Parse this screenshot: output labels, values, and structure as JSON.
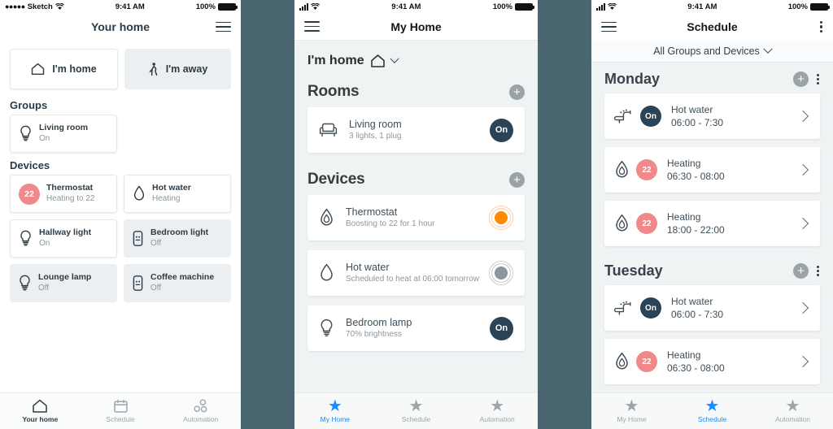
{
  "panels": {
    "home": {
      "status": {
        "carrier": "Sketch",
        "time": "9:41 AM",
        "battery": "100%"
      },
      "nav": {
        "title": "Your home",
        "menu_icon": "hamburger-icon"
      },
      "modes": [
        {
          "label": "I'm home",
          "icon": "home-icon",
          "state": "active"
        },
        {
          "label": "I'm away",
          "icon": "walking-person-icon",
          "state": "inactive"
        }
      ],
      "groups_heading": "Groups",
      "groups": [
        {
          "name": "Living room",
          "status": "On",
          "icon": "bulb-icon",
          "state": "on"
        }
      ],
      "devices_heading": "Devices",
      "devices": [
        {
          "name": "Thermostat",
          "status": "Heating to 22",
          "icon": "temp-badge",
          "badge": "22",
          "state": "on"
        },
        {
          "name": "Hot water",
          "status": "Heating",
          "icon": "droplet-icon",
          "state": "on"
        },
        {
          "name": "Hallway light",
          "status": "On",
          "icon": "bulb-icon",
          "state": "on"
        },
        {
          "name": "Bedroom light",
          "status": "Off",
          "icon": "plug-icon",
          "state": "off"
        },
        {
          "name": "Lounge lamp",
          "status": "Off",
          "icon": "bulb-icon",
          "state": "off"
        },
        {
          "name": "Coffee machine",
          "status": "Off",
          "icon": "plug-icon",
          "state": "off"
        }
      ],
      "tabs": [
        {
          "label": "Your home",
          "icon": "home-icon",
          "selected": true
        },
        {
          "label": "Schedule",
          "icon": "calendar-icon",
          "selected": false
        },
        {
          "label": "Automation",
          "icon": "automation-nodes-icon",
          "selected": false
        }
      ]
    },
    "myhome": {
      "status": {
        "time": "9:41 AM",
        "battery": "100%"
      },
      "nav": {
        "title": "My Home",
        "menu_icon": "hamburger-icon"
      },
      "mode": {
        "label": "I'm home",
        "icon": "home-icon",
        "chevron": "chevron-down-icon"
      },
      "rooms_heading": "Rooms",
      "rooms_add": "+",
      "rooms": [
        {
          "name": "Living room",
          "sub": "3 lights, 1 plug",
          "icon": "armchair-icon",
          "toggle": "On",
          "toggle_type": "pill"
        }
      ],
      "devices_heading": "Devices",
      "devices_add": "+",
      "devices": [
        {
          "name": "Thermostat",
          "sub": "Boosting to 22 for 1 hour",
          "icon": "flame-droplet-icon",
          "toggle_type": "dial",
          "toggle_state": "orange"
        },
        {
          "name": "Hot water",
          "sub": "Scheduled to heat at 06:00 tomorrow",
          "icon": "droplet-icon",
          "toggle_type": "dial",
          "toggle_state": "grey"
        },
        {
          "name": "Bedroom lamp",
          "sub": "70% brightness",
          "icon": "bulb-icon",
          "toggle": "On",
          "toggle_type": "pill"
        }
      ],
      "tabs": [
        {
          "label": "My Home",
          "icon": "star-icon",
          "selected": true
        },
        {
          "label": "Schedule",
          "icon": "star-icon",
          "selected": false
        },
        {
          "label": "Automation",
          "icon": "star-icon",
          "selected": false
        }
      ]
    },
    "schedule": {
      "status": {
        "time": "9:41 AM",
        "battery": "100%"
      },
      "nav": {
        "title": "Schedule",
        "menu_icon": "hamburger-icon",
        "overflow_icon": "kebab-icon"
      },
      "filter": {
        "label": "All Groups and Devices",
        "chevron": "chevron-down-icon"
      },
      "days": [
        {
          "name": "Monday",
          "add": "+",
          "entries": [
            {
              "name": "Hot water",
              "time": "06:00 - 7:30",
              "icon": "tap-icon",
              "badge": "On",
              "badge_type": "on"
            },
            {
              "name": "Heating",
              "time": "06:30 - 08:00",
              "icon": "flame-droplet-icon",
              "badge": "22",
              "badge_type": "temp"
            },
            {
              "name": "Heating",
              "time": "18:00 - 22:00",
              "icon": "flame-droplet-icon",
              "badge": "22",
              "badge_type": "temp"
            }
          ]
        },
        {
          "name": "Tuesday",
          "add": "+",
          "entries": [
            {
              "name": "Hot water",
              "time": "06:00 - 7:30",
              "icon": "tap-icon",
              "badge": "On",
              "badge_type": "on"
            },
            {
              "name": "Heating",
              "time": "06:30 - 08:00",
              "icon": "flame-droplet-icon",
              "badge": "22",
              "badge_type": "temp"
            }
          ]
        }
      ],
      "tabs": [
        {
          "label": "My Home",
          "icon": "star-icon",
          "selected": false
        },
        {
          "label": "Schedule",
          "icon": "star-icon",
          "selected": true
        },
        {
          "label": "Automation",
          "icon": "star-icon",
          "selected": false
        }
      ]
    }
  },
  "colors": {
    "background_gap": "#4a6670",
    "accent_navy": "#2b4356",
    "accent_red": "#f08a8a",
    "accent_orange": "#ff8a00",
    "accent_blue": "#1a8cff",
    "panel_grey": "#eff3f4"
  }
}
